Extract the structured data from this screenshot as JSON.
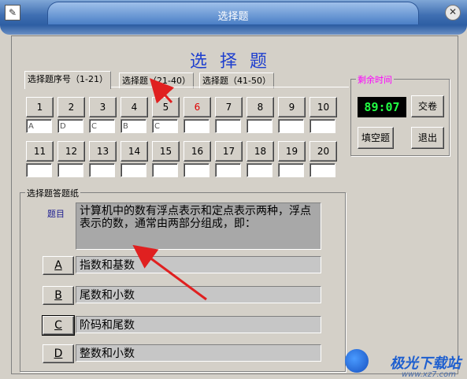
{
  "window": {
    "title": "选择题"
  },
  "main_title": "选择题",
  "tabs": [
    {
      "label": "选择题序号（1-21）"
    },
    {
      "label": "选择题（21-40）"
    },
    {
      "label": "选择题（41-50）"
    }
  ],
  "questions_row1": [
    {
      "num": "1",
      "answer": "A"
    },
    {
      "num": "2",
      "answer": "D"
    },
    {
      "num": "3",
      "answer": "C"
    },
    {
      "num": "4",
      "answer": "B"
    },
    {
      "num": "5",
      "answer": "C"
    },
    {
      "num": "6",
      "answer": ""
    },
    {
      "num": "7",
      "answer": ""
    },
    {
      "num": "8",
      "answer": ""
    },
    {
      "num": "9",
      "answer": ""
    },
    {
      "num": "10",
      "answer": ""
    }
  ],
  "questions_row2": [
    {
      "num": "11",
      "answer": ""
    },
    {
      "num": "12",
      "answer": ""
    },
    {
      "num": "13",
      "answer": ""
    },
    {
      "num": "14",
      "answer": ""
    },
    {
      "num": "15",
      "answer": ""
    },
    {
      "num": "16",
      "answer": ""
    },
    {
      "num": "17",
      "answer": ""
    },
    {
      "num": "18",
      "answer": ""
    },
    {
      "num": "19",
      "answer": ""
    },
    {
      "num": "20",
      "answer": ""
    }
  ],
  "current_question_color": "#e00000",
  "timer": {
    "label": "剩余时间",
    "value": "89:07",
    "label_color": "#ff00ff"
  },
  "buttons": {
    "submit": "交卷",
    "fill_blank": "填空题",
    "exit": "退出"
  },
  "answer_sheet": {
    "label": "选择题答题纸",
    "question_label": "题目",
    "question_text": "计算机中的数有浮点表示和定点表示两种，浮点表示的数，通常由两部分组成，即：",
    "options": [
      {
        "key": "A",
        "text": "指数和基数"
      },
      {
        "key": "B",
        "text": "尾数和小数"
      },
      {
        "key": "C",
        "text": "阶码和尾数"
      },
      {
        "key": "D",
        "text": "整数和小数"
      }
    ],
    "selected": "C"
  },
  "watermark": {
    "text": "极光下载站",
    "url": "www.xz7.com"
  }
}
